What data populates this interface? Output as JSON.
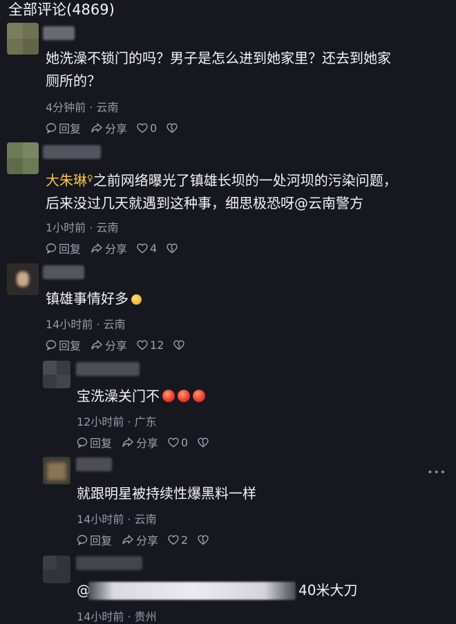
{
  "header": {
    "title": "全部评论(4869)"
  },
  "labels": {
    "reply": "回复",
    "share": "分享",
    "more": "•••"
  },
  "comments": [
    {
      "text_line1": "她洗澡不锁门的吗？男子是怎么进到她家里？还去到她家",
      "text_line2": "厕所的？",
      "meta": "4分钟前 · 云南",
      "likes": "0"
    },
    {
      "author": "大朱琳",
      "author_badge": "♀",
      "text_line1": "之前网络曝光了镇雄长坝的一处河坝的污染问题，",
      "text_line2": "后来没过几天就遇到这种事，细思极恐呀@云南警方",
      "meta": "1小时前 · 云南",
      "likes": "4"
    },
    {
      "text_line1": "镇雄事情好多",
      "meta": "14小时前 · 云南",
      "likes": "12"
    },
    {
      "text_line1": "宝洗澡关门不",
      "meta": "12小时前 · 广东",
      "likes": "0"
    },
    {
      "text_line1": "就跟明星被持续性爆黑料一样",
      "meta": "14小时前 · 云南",
      "likes": "2"
    },
    {
      "text_prefix": "@",
      "text_line1": "40米大刀",
      "meta": "14小时前 · 贵州"
    }
  ],
  "colors": {
    "background": "#17171f",
    "author": "#f5c64b",
    "meta": "#9a9aa6"
  }
}
